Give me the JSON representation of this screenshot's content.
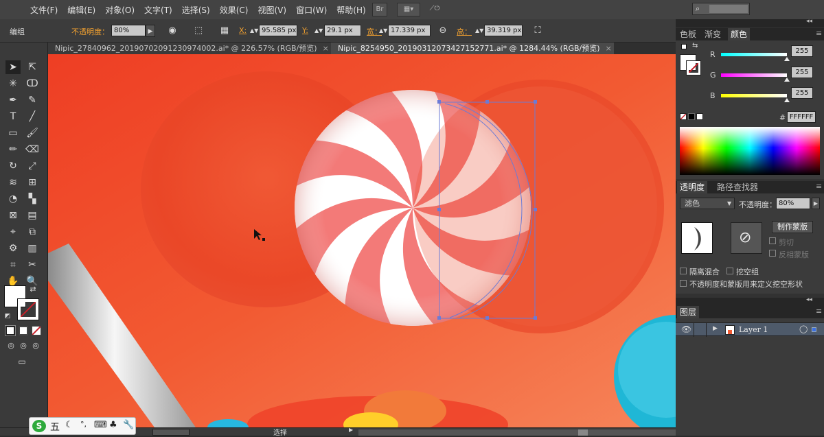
{
  "menubar": {
    "items": [
      "文件(F)",
      "编辑(E)",
      "对象(O)",
      "文字(T)",
      "选择(S)",
      "效果(C)",
      "视图(V)",
      "窗口(W)",
      "帮助(H)"
    ],
    "br_label": "Br"
  },
  "control": {
    "group_label": "编组",
    "opacity_label": "不透明度：",
    "opacity_value": "80%",
    "x_label": "X:",
    "x_value": "95.585 px",
    "y_label": "Y:",
    "y_value": "29.1 px",
    "w_label": "宽：",
    "w_value": "17.339 px",
    "h_label": "高：",
    "h_value": "39.319 px"
  },
  "tabs": [
    {
      "label": "Nipic_27840962_20190702091230974002.ai* @ 226.57% (RGB/预览)",
      "close": "×"
    },
    {
      "label": "Nipic_8254950_20190312073427152771.ai* @ 1284.44% (RGB/预览)",
      "close": "×"
    }
  ],
  "color_panel": {
    "tabs": [
      "色板",
      "渐变",
      "颜色"
    ],
    "r_label": "R",
    "r_value": "255",
    "r_level": 1.0,
    "g_label": "G",
    "g_value": "255",
    "g_level": 1.0,
    "b_label": "B",
    "b_value": "255",
    "b_level": 1.0,
    "hex_label": "#",
    "hex_value": "FFFFFF"
  },
  "transparency_panel": {
    "tabs": [
      "透明度",
      "路径查找器"
    ],
    "blend_mode": "滤色",
    "opacity_label": "不透明度：",
    "opacity_value": "80%",
    "make_mask": "制作蒙版",
    "clip": "剪切",
    "invert_mask": "反相蒙版",
    "isolate_blending": "隔离混合",
    "knockout_group": "挖空组",
    "opacity_mask_define": "不透明度和蒙版用来定义挖空形状"
  },
  "layers_panel": {
    "tabs": [
      "图层"
    ],
    "layer_name": "Layer 1"
  },
  "status": {
    "tool_label": "选择"
  },
  "ime": {
    "char": "五"
  },
  "colors": {
    "canvas_bg": "#f25a32",
    "candy_red": "#f37a78",
    "accent_orange": "#f0a030"
  }
}
